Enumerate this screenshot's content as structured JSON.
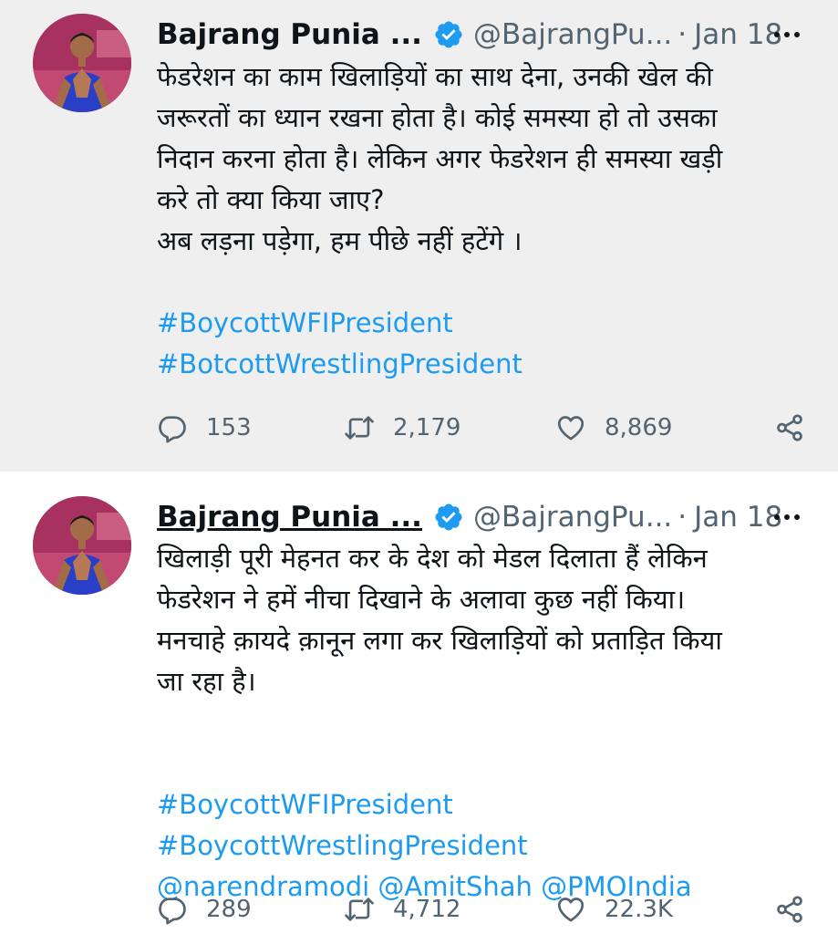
{
  "tweets": [
    {
      "author_name": "Bajrang Punia ...",
      "handle": "@BajrangPu...",
      "separator": "·",
      "date": "Jan 18",
      "lines": [
        "फेडरेशन का काम खिलाड़ियों का साथ देना, उनकी खेल की",
        "जरूरतों का ध्यान रखना होता है। कोई समस्या हो तो उसका",
        "निदान करना होता है। लेकिन अगर फेडरेशन ही समस्या खड़ी",
        "करे तो क्या किया जाए?",
        "अब लड़ना पड़ेगा, हम पीछे नहीं हटेंगे ।"
      ],
      "links": [
        "#BoycottWFIPresident",
        "#BotcottWrestlingPresident"
      ],
      "counts": {
        "replies": "153",
        "retweets": "2,179",
        "likes": "8,869"
      }
    },
    {
      "author_name": "Bajrang Punia ...",
      "handle": "@BajrangPu...",
      "separator": "·",
      "date": "Jan 18",
      "lines": [
        "खिलाड़ी पूरी मेहनत कर के देश को मेडल दिलाता हैं लेकिन",
        "फेडरेशन ने हमें नीचा दिखाने के अलावा कुछ नहीं किया।",
        "मनचाहे क़ायदे क़ानून लगा कर खिलाड़ियों को प्रताड़ित किया",
        "जा रहा है।"
      ],
      "links": [
        "#BoycottWFIPresident",
        "#BoycottWrestlingPresident",
        "@narendramodi @AmitShah @PMOIndia"
      ],
      "counts": {
        "replies": "289",
        "retweets": "4,712",
        "likes": "22.3K"
      }
    }
  ],
  "icons": {
    "verified": "verified-badge-icon",
    "more": "more-dots-icon",
    "reply": "reply-icon",
    "retweet": "retweet-icon",
    "like": "heart-icon",
    "share": "share-icon"
  },
  "colors": {
    "link": "#1d9bf0",
    "secondary_text": "#536471",
    "primary_text": "#0f1419",
    "first_tweet_background": "#efefef"
  }
}
